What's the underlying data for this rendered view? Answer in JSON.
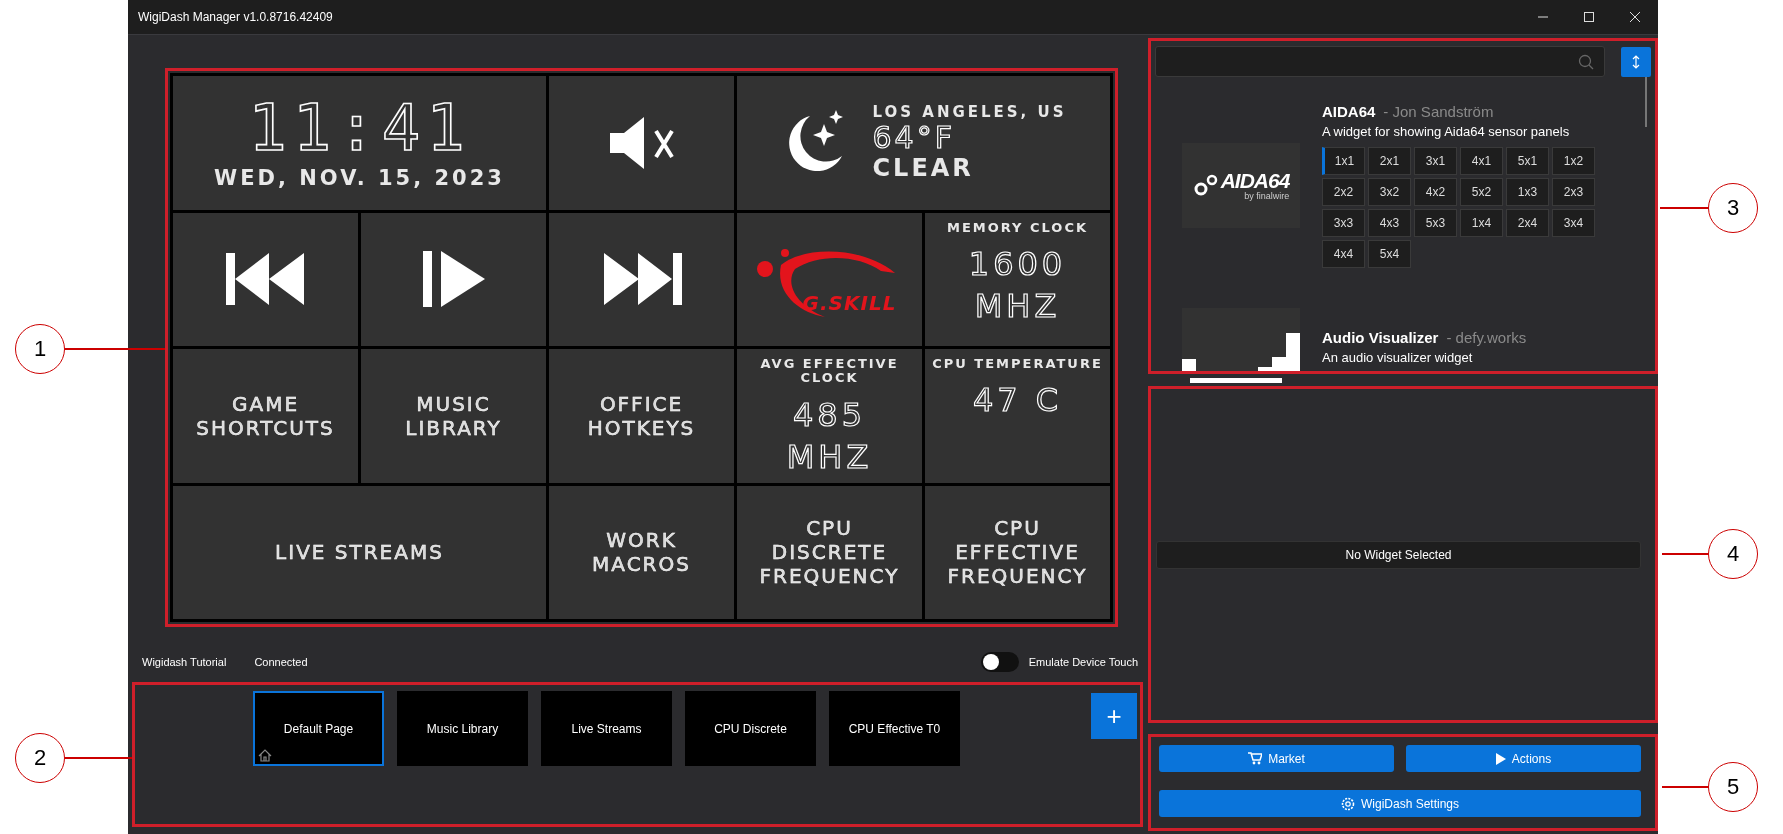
{
  "window": {
    "title": "WigiDash Manager v1.0.8716.42409"
  },
  "dashboard": {
    "tiles": [
      {
        "kind": "clock",
        "wide": true,
        "time": "11:41",
        "date": "WED, NOV. 15, 2023"
      },
      {
        "kind": "mute",
        "wide": false
      },
      {
        "kind": "weather",
        "wide": true,
        "city": "LOS ANGELES, US",
        "temp": "64°F",
        "condition": "CLEAR"
      },
      {
        "kind": "previous",
        "wide": false
      },
      {
        "kind": "playpause",
        "wide": false
      },
      {
        "kind": "next",
        "wide": false
      },
      {
        "kind": "logo",
        "wide": false,
        "text": "G.SKILL"
      },
      {
        "kind": "sensor",
        "wide": false,
        "title": "MEMORY CLOCK",
        "value": "1600",
        "unit": "MHZ"
      },
      {
        "kind": "label",
        "wide": false,
        "text": "GAME SHORTCUTS"
      },
      {
        "kind": "label",
        "wide": false,
        "text": "MUSIC LIBRARY"
      },
      {
        "kind": "label",
        "wide": false,
        "text": "OFFICE HOTKEYS"
      },
      {
        "kind": "sensor",
        "wide": false,
        "title": "AVG EFFECTIVE CLOCK",
        "value": "485",
        "unit": "MHZ"
      },
      {
        "kind": "sensor",
        "wide": false,
        "title": "CPU TEMPERATURE",
        "value": "47 C"
      },
      {
        "kind": "label",
        "wide": true,
        "text": "LIVE STREAMS"
      },
      {
        "kind": "label",
        "wide": false,
        "text": "WORK MACROS"
      },
      {
        "kind": "label",
        "wide": false,
        "text": "CPU DISCRETE FREQUENCY"
      },
      {
        "kind": "label",
        "wide": false,
        "text": "CPU EFFECTIVE FREQUENCY"
      }
    ]
  },
  "status": {
    "items": [
      "Wigidash Tutorial",
      "Connected"
    ],
    "toggle": {
      "label": "Emulate Device Touch",
      "on": false
    }
  },
  "pages": {
    "items": [
      {
        "label": "Default Page",
        "selected": true,
        "home": true
      },
      {
        "label": "Music Library",
        "selected": false,
        "home": false
      },
      {
        "label": "Live Streams",
        "selected": false,
        "home": false
      },
      {
        "label": "CPU Discrete",
        "selected": false,
        "home": false
      },
      {
        "label": "CPU Effective T0",
        "selected": false,
        "home": false
      }
    ],
    "add_button": "+"
  },
  "widget_browser": {
    "widgets": [
      {
        "kind": "aida",
        "name": "AIDA64",
        "author": "- Jon Sandström",
        "description": "A widget for showing Aida64 sensor panels",
        "logo_text": "AIDA64",
        "logo_subtext": "by finalwire",
        "sizes": [
          {
            "label": "1x1",
            "selected": true
          },
          {
            "label": "2x1",
            "selected": false
          },
          {
            "label": "3x1",
            "selected": false
          },
          {
            "label": "4x1",
            "selected": false
          },
          {
            "label": "5x1",
            "selected": false
          },
          {
            "label": "1x2",
            "selected": false
          },
          {
            "label": "2x2",
            "selected": false
          },
          {
            "label": "3x2",
            "selected": false
          },
          {
            "label": "4x2",
            "selected": false
          },
          {
            "label": "5x2",
            "selected": false
          },
          {
            "label": "1x3",
            "selected": false
          },
          {
            "label": "2x3",
            "selected": false
          },
          {
            "label": "3x3",
            "selected": false
          },
          {
            "label": "4x3",
            "selected": false
          },
          {
            "label": "5x3",
            "selected": false
          },
          {
            "label": "1x4",
            "selected": false
          },
          {
            "label": "2x4",
            "selected": false
          },
          {
            "label": "3x4",
            "selected": false
          },
          {
            "label": "4x4",
            "selected": false
          },
          {
            "label": "5x4",
            "selected": false
          }
        ]
      },
      {
        "kind": "visualizer",
        "name": "Audio Visualizer",
        "author": "- defy.works",
        "description": "An audio visualizer widget"
      }
    ]
  },
  "details": {
    "message": "No Widget Selected"
  },
  "actions": {
    "buttons": [
      "Market",
      "Actions",
      "WigiDash Settings"
    ]
  },
  "callouts": [
    "1",
    "2",
    "3",
    "4",
    "5"
  ]
}
